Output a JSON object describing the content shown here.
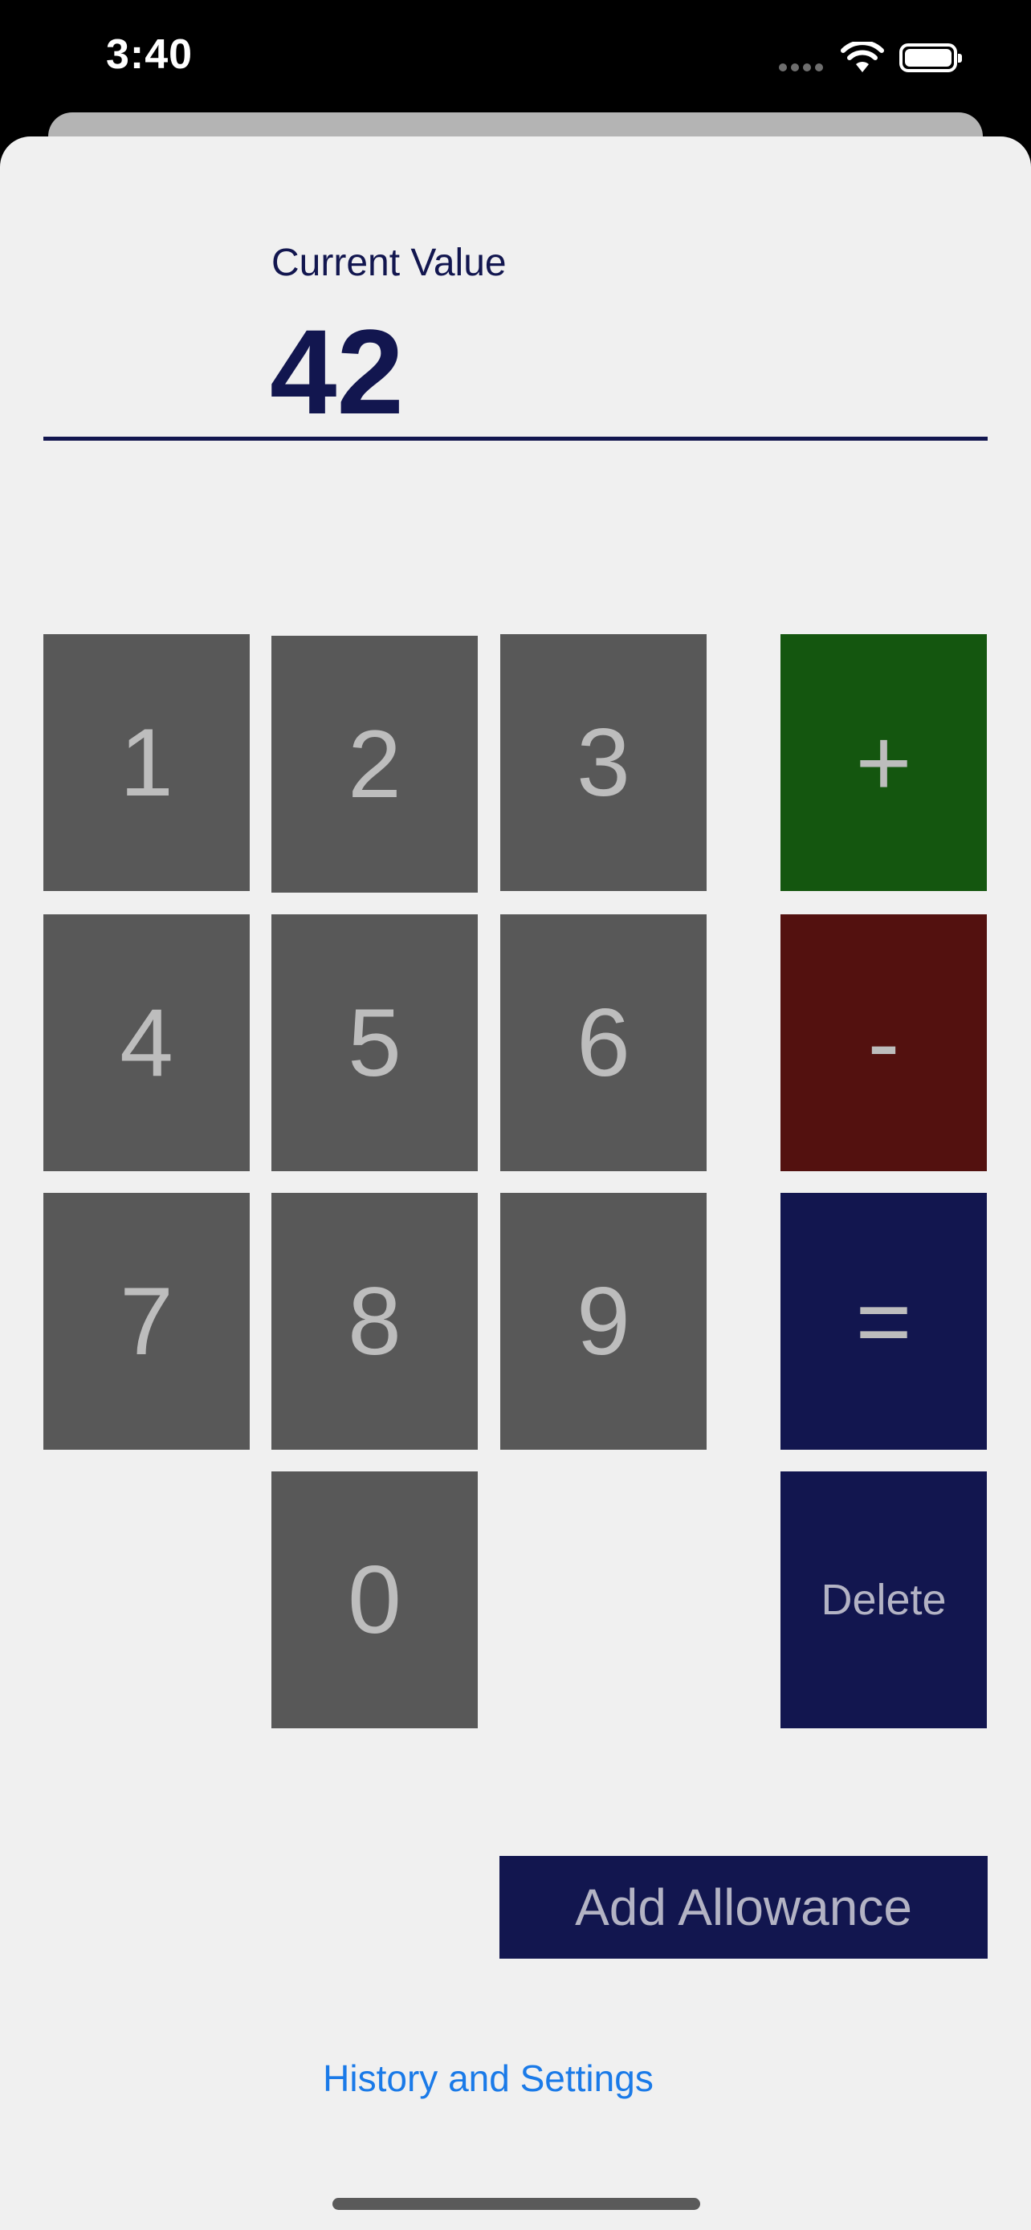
{
  "status_bar": {
    "time": "3:40",
    "icons": [
      "cellular-signal-icon",
      "wifi-icon",
      "battery-icon"
    ]
  },
  "display": {
    "label": "Current Value",
    "value": "42"
  },
  "keypad": {
    "digits": [
      "1",
      "2",
      "3",
      "4",
      "5",
      "6",
      "7",
      "8",
      "9",
      "0"
    ],
    "operators": {
      "add": "+",
      "subtract": "-",
      "equals": "=",
      "delete": "Delete"
    }
  },
  "actions": {
    "add_allowance": "Add Allowance",
    "history_settings": "History and Settings"
  },
  "colors": {
    "navy": "#12164f",
    "digit_key": "#585858",
    "add_key": "#14560f",
    "subtract_key": "#53110f",
    "link": "#1a7ae8",
    "background": "#f0f0f0"
  }
}
